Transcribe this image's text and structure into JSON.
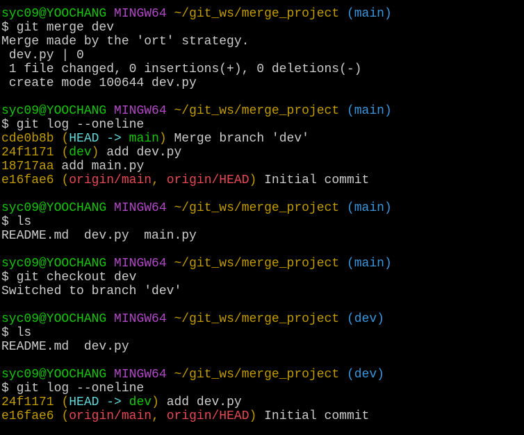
{
  "colors": {
    "background": "#000000",
    "default": "#c0c0c0",
    "user_host": "#16c60c",
    "msystem": "#b148c6",
    "path": "#c19c00",
    "branch": "#3a96dd",
    "hash": "#c19c00",
    "head": "#61d6d6",
    "local_branch": "#16c60c",
    "remote_branch": "#e74856",
    "text": "#cccccc"
  },
  "terminal": {
    "lines": [
      {
        "segments": [
          {
            "text": "syc09@YOOCHANG",
            "color": "user_host"
          },
          {
            "text": " ",
            "color": "default"
          },
          {
            "text": "MINGW64",
            "color": "msystem"
          },
          {
            "text": " ",
            "color": "default"
          },
          {
            "text": "~/git_ws/merge_project",
            "color": "path"
          },
          {
            "text": " ",
            "color": "default"
          },
          {
            "text": "(main)",
            "color": "branch"
          }
        ]
      },
      {
        "segments": [
          {
            "text": "$ git merge dev",
            "color": "text"
          }
        ]
      },
      {
        "segments": [
          {
            "text": "Merge made by the 'ort' strategy.",
            "color": "text"
          }
        ]
      },
      {
        "segments": [
          {
            "text": " dev.py | 0",
            "color": "text"
          }
        ]
      },
      {
        "segments": [
          {
            "text": " 1 file changed, 0 insertions(+), 0 deletions(-)",
            "color": "text"
          }
        ]
      },
      {
        "segments": [
          {
            "text": " create mode 100644 dev.py",
            "color": "text"
          }
        ]
      },
      {
        "segments": []
      },
      {
        "segments": [
          {
            "text": "syc09@YOOCHANG",
            "color": "user_host"
          },
          {
            "text": " ",
            "color": "default"
          },
          {
            "text": "MINGW64",
            "color": "msystem"
          },
          {
            "text": " ",
            "color": "default"
          },
          {
            "text": "~/git_ws/merge_project",
            "color": "path"
          },
          {
            "text": " ",
            "color": "default"
          },
          {
            "text": "(main)",
            "color": "branch"
          }
        ]
      },
      {
        "segments": [
          {
            "text": "$ git log --oneline",
            "color": "text"
          }
        ]
      },
      {
        "segments": [
          {
            "text": "cde0b8b",
            "color": "hash"
          },
          {
            "text": " ",
            "color": "text"
          },
          {
            "text": "(",
            "color": "hash"
          },
          {
            "text": "HEAD -> ",
            "color": "head"
          },
          {
            "text": "main",
            "color": "local_branch"
          },
          {
            "text": ")",
            "color": "hash"
          },
          {
            "text": " Merge branch 'dev'",
            "color": "text"
          }
        ]
      },
      {
        "segments": [
          {
            "text": "24f1171",
            "color": "hash"
          },
          {
            "text": " ",
            "color": "text"
          },
          {
            "text": "(",
            "color": "hash"
          },
          {
            "text": "dev",
            "color": "local_branch"
          },
          {
            "text": ")",
            "color": "hash"
          },
          {
            "text": " add dev.py",
            "color": "text"
          }
        ]
      },
      {
        "segments": [
          {
            "text": "18717aa",
            "color": "hash"
          },
          {
            "text": " add main.py",
            "color": "text"
          }
        ]
      },
      {
        "segments": [
          {
            "text": "e16fae6",
            "color": "hash"
          },
          {
            "text": " ",
            "color": "text"
          },
          {
            "text": "(",
            "color": "hash"
          },
          {
            "text": "origin/main",
            "color": "remote_branch"
          },
          {
            "text": ", ",
            "color": "hash"
          },
          {
            "text": "origin/HEAD",
            "color": "remote_branch"
          },
          {
            "text": ")",
            "color": "hash"
          },
          {
            "text": " Initial commit",
            "color": "text"
          }
        ]
      },
      {
        "segments": []
      },
      {
        "segments": [
          {
            "text": "syc09@YOOCHANG",
            "color": "user_host"
          },
          {
            "text": " ",
            "color": "default"
          },
          {
            "text": "MINGW64",
            "color": "msystem"
          },
          {
            "text": " ",
            "color": "default"
          },
          {
            "text": "~/git_ws/merge_project",
            "color": "path"
          },
          {
            "text": " ",
            "color": "default"
          },
          {
            "text": "(main)",
            "color": "branch"
          }
        ]
      },
      {
        "segments": [
          {
            "text": "$ ls",
            "color": "text"
          }
        ]
      },
      {
        "segments": [
          {
            "text": "README.md  dev.py  main.py",
            "color": "text"
          }
        ]
      },
      {
        "segments": []
      },
      {
        "segments": [
          {
            "text": "syc09@YOOCHANG",
            "color": "user_host"
          },
          {
            "text": " ",
            "color": "default"
          },
          {
            "text": "MINGW64",
            "color": "msystem"
          },
          {
            "text": " ",
            "color": "default"
          },
          {
            "text": "~/git_ws/merge_project",
            "color": "path"
          },
          {
            "text": " ",
            "color": "default"
          },
          {
            "text": "(main)",
            "color": "branch"
          }
        ]
      },
      {
        "segments": [
          {
            "text": "$ git checkout dev",
            "color": "text"
          }
        ]
      },
      {
        "segments": [
          {
            "text": "Switched to branch 'dev'",
            "color": "text"
          }
        ]
      },
      {
        "segments": []
      },
      {
        "segments": [
          {
            "text": "syc09@YOOCHANG",
            "color": "user_host"
          },
          {
            "text": " ",
            "color": "default"
          },
          {
            "text": "MINGW64",
            "color": "msystem"
          },
          {
            "text": " ",
            "color": "default"
          },
          {
            "text": "~/git_ws/merge_project",
            "color": "path"
          },
          {
            "text": " ",
            "color": "default"
          },
          {
            "text": "(dev)",
            "color": "branch"
          }
        ]
      },
      {
        "segments": [
          {
            "text": "$ ls",
            "color": "text"
          }
        ]
      },
      {
        "segments": [
          {
            "text": "README.md  dev.py",
            "color": "text"
          }
        ]
      },
      {
        "segments": []
      },
      {
        "segments": [
          {
            "text": "syc09@YOOCHANG",
            "color": "user_host"
          },
          {
            "text": " ",
            "color": "default"
          },
          {
            "text": "MINGW64",
            "color": "msystem"
          },
          {
            "text": " ",
            "color": "default"
          },
          {
            "text": "~/git_ws/merge_project",
            "color": "path"
          },
          {
            "text": " ",
            "color": "default"
          },
          {
            "text": "(dev)",
            "color": "branch"
          }
        ]
      },
      {
        "segments": [
          {
            "text": "$ git log --oneline",
            "color": "text"
          }
        ]
      },
      {
        "segments": [
          {
            "text": "24f1171",
            "color": "hash"
          },
          {
            "text": " ",
            "color": "text"
          },
          {
            "text": "(",
            "color": "hash"
          },
          {
            "text": "HEAD -> ",
            "color": "head"
          },
          {
            "text": "dev",
            "color": "local_branch"
          },
          {
            "text": ")",
            "color": "hash"
          },
          {
            "text": " add dev.py",
            "color": "text"
          }
        ]
      },
      {
        "segments": [
          {
            "text": "e16fae6",
            "color": "hash"
          },
          {
            "text": " ",
            "color": "text"
          },
          {
            "text": "(",
            "color": "hash"
          },
          {
            "text": "origin/main",
            "color": "remote_branch"
          },
          {
            "text": ", ",
            "color": "hash"
          },
          {
            "text": "origin/HEAD",
            "color": "remote_branch"
          },
          {
            "text": ")",
            "color": "hash"
          },
          {
            "text": " Initial commit",
            "color": "text"
          }
        ]
      }
    ]
  }
}
